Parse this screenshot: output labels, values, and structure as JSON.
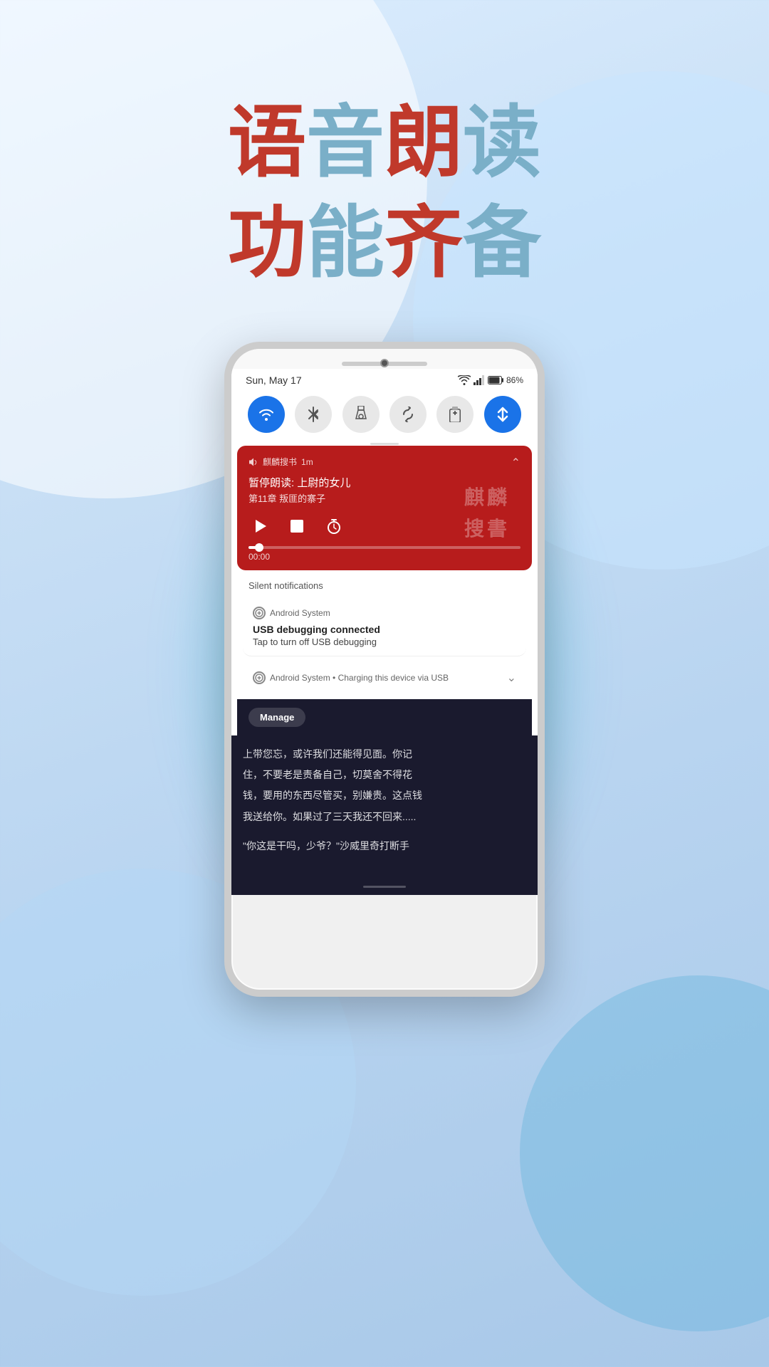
{
  "background": {
    "color_start": "#ddeeff",
    "color_end": "#a8c8e8"
  },
  "hero": {
    "line1": "语音朗读",
    "line2": "功能齐备",
    "line1_colors": [
      "red",
      "blue",
      "red",
      "blue"
    ],
    "line2_colors": [
      "red",
      "blue",
      "red",
      "blue"
    ]
  },
  "phone": {
    "status_bar": {
      "date": "Sun, May 17",
      "battery": "86%",
      "wifi": true,
      "signal": true
    },
    "quick_settings": [
      {
        "id": "wifi",
        "icon": "wifi",
        "active": true,
        "label": "WiFi"
      },
      {
        "id": "bluetooth",
        "icon": "bluetooth",
        "active": false,
        "label": "Bluetooth"
      },
      {
        "id": "flashlight",
        "icon": "flashlight",
        "active": false,
        "label": "Flashlight"
      },
      {
        "id": "rotate",
        "icon": "rotate",
        "active": false,
        "label": "Auto-rotate"
      },
      {
        "id": "battery_saver",
        "icon": "battery_saver",
        "active": false,
        "label": "Battery Saver"
      },
      {
        "id": "data",
        "icon": "data",
        "active": true,
        "label": "Data"
      }
    ],
    "media_notification": {
      "app_name": "麒麟搜书",
      "time_ago": "1m",
      "title": "暂停朗读: 上尉的女儿",
      "subtitle": "第11章 叛匪的寨子",
      "progress_time": "00:00",
      "logo_chars": [
        "麒",
        "麟",
        "搜",
        "書"
      ]
    },
    "silent_section": {
      "header": "Silent notifications"
    },
    "notification_usb": {
      "app": "Android System",
      "title": "USB debugging connected",
      "body": "Tap to turn off USB debugging"
    },
    "notification_charging": {
      "app": "Android System",
      "dot": "•",
      "body": "Charging this device via USB"
    },
    "manage_button": {
      "label": "Manage"
    },
    "book_text": {
      "lines": [
        "上带您忘，或许我们还能得见面。你记",
        "住，不要老是责备自己，切莫舍不得花",
        "钱，要用的东西尽管买，别嫌贵。这点钱",
        "我送给你。如果过了三天我还不回来.....",
        "",
        "“你这是干吗，少爷？”沙威里奇打断手"
      ]
    }
  }
}
